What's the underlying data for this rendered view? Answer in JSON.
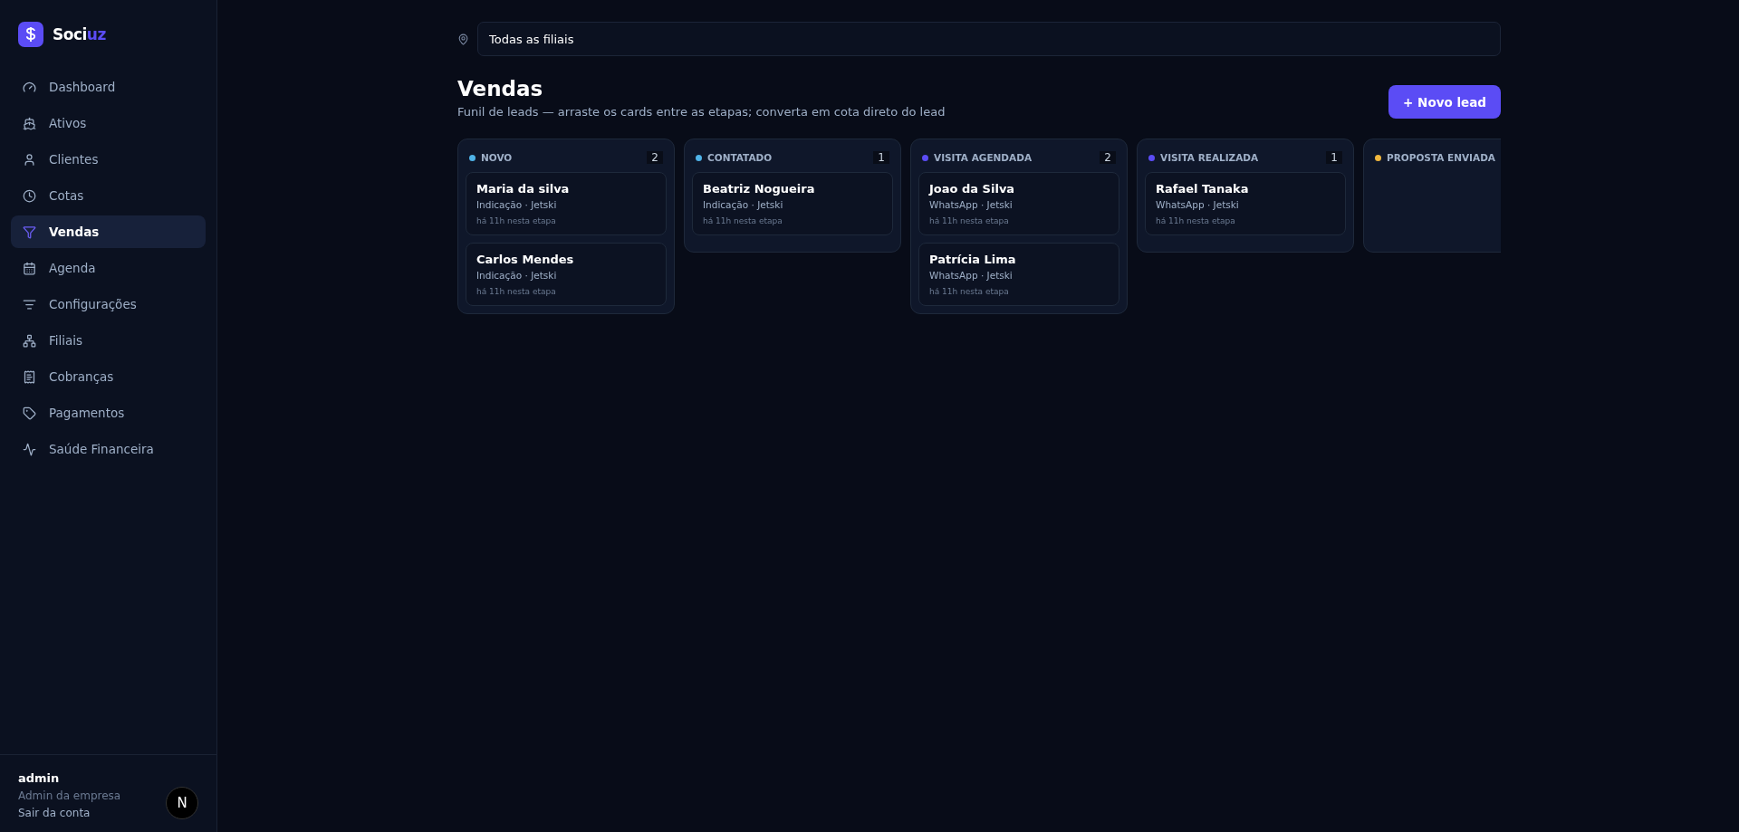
{
  "brand": {
    "name": "Soci",
    "accent": "uz"
  },
  "nav": [
    {
      "label": "Dashboard",
      "selected": false
    },
    {
      "label": "Ativos",
      "selected": false
    },
    {
      "label": "Clientes",
      "selected": false
    },
    {
      "label": "Cotas",
      "selected": false
    },
    {
      "label": "Vendas",
      "selected": true
    },
    {
      "label": "Agenda",
      "selected": false
    },
    {
      "label": "Configurações",
      "selected": false
    },
    {
      "label": "Filiais",
      "selected": false
    },
    {
      "label": "Cobranças",
      "selected": false
    },
    {
      "label": "Pagamentos",
      "selected": false
    },
    {
      "label": "Saúde Financeira",
      "selected": false
    }
  ],
  "user": {
    "name": "admin",
    "role": "Admin da empresa",
    "logout": "Sair da conta"
  },
  "dev_badge": "N",
  "branch_filter": {
    "value": "Todas as filiais"
  },
  "page": {
    "title": "Vendas",
    "subtitle": "Funil de leads — arraste os cards entre as etapas; converta em cota direto do lead",
    "new_button": "+ Novo lead"
  },
  "columns": [
    {
      "title": "NOVO",
      "color": "#4fb3e8",
      "count": "2",
      "leads": [
        {
          "name": "Maria da silva",
          "meta": "Indicação · Jetski",
          "age": "há 11h nesta etapa"
        },
        {
          "name": "Carlos Mendes",
          "meta": "Indicação · Jetski",
          "age": "há 11h nesta etapa"
        }
      ]
    },
    {
      "title": "CONTATADO",
      "color": "#4fb3e8",
      "count": "1",
      "leads": [
        {
          "name": "Beatriz Nogueira",
          "meta": "Indicação · Jetski",
          "age": "há 11h nesta etapa"
        }
      ]
    },
    {
      "title": "VISITA AGENDADA",
      "color": "#5b4cf5",
      "count": "2",
      "leads": [
        {
          "name": "Joao da Silva",
          "meta": "WhatsApp · Jetski",
          "age": "há 11h nesta etapa"
        },
        {
          "name": "Patrícia Lima",
          "meta": "WhatsApp · Jetski",
          "age": "há 11h nesta etapa"
        }
      ]
    },
    {
      "title": "VISITA REALIZADA",
      "color": "#5b4cf5",
      "count": "1",
      "leads": [
        {
          "name": "Rafael Tanaka",
          "meta": "WhatsApp · Jetski",
          "age": "há 11h nesta etapa"
        }
      ]
    },
    {
      "title": "PROPOSTA ENVIADA",
      "color": "#f0b73e"
    }
  ]
}
